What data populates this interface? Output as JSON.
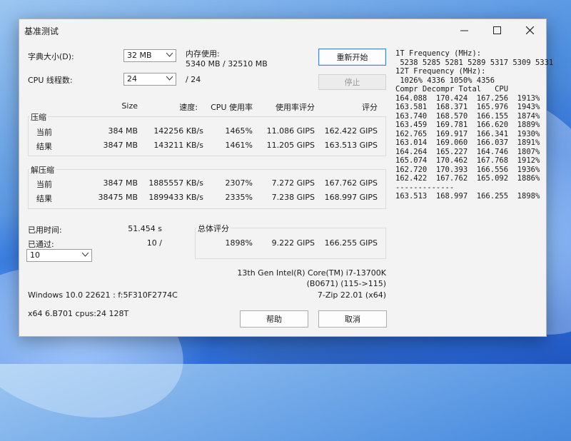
{
  "window": {
    "title": "基准测试",
    "controls": {
      "minimize": "—",
      "maximize": "☐",
      "close": "✕"
    }
  },
  "settings": {
    "dict_size_label": "字典大小(D):",
    "dict_size_value": "32 MB",
    "threads_label": "CPU 线程数:",
    "threads_value": "24",
    "threads_total": "/ 24",
    "memory_label": "内存使用:",
    "memory_value": "5340 MB / 32510 MB"
  },
  "buttons": {
    "restart": "重新开始",
    "stop": "停止",
    "help": "帮助",
    "cancel": "取消"
  },
  "table_header": {
    "size": "Size",
    "speed": "速度:",
    "cpu_usage": "CPU 使用率",
    "rating_per_usage": "使用率评分",
    "rating": "评分"
  },
  "compress": {
    "title": "压缩",
    "rows": [
      {
        "label": "当前",
        "size": "384 MB",
        "speed": "142256 KB/s",
        "usage": "1465%",
        "rpu": "11.086 GIPS",
        "rating": "162.422 GIPS"
      },
      {
        "label": "结果",
        "size": "3847 MB",
        "speed": "143211 KB/s",
        "usage": "1461%",
        "rpu": "11.205 GIPS",
        "rating": "163.513 GIPS"
      }
    ]
  },
  "decompress": {
    "title": "解压缩",
    "rows": [
      {
        "label": "当前",
        "size": "3847 MB",
        "speed": "1885557 KB/s",
        "usage": "2307%",
        "rpu": "7.272 GIPS",
        "rating": "167.762 GIPS"
      },
      {
        "label": "结果",
        "size": "38475 MB",
        "speed": "1899433 KB/s",
        "usage": "2335%",
        "rpu": "7.238 GIPS",
        "rating": "168.997 GIPS"
      }
    ]
  },
  "timing": {
    "elapsed_label": "已用时间:",
    "elapsed_value": "51.454 s",
    "passes_label": "已通过:",
    "passes_value": "10 /",
    "passes_select": "10"
  },
  "total": {
    "title": "总体评分",
    "usage": "1898%",
    "rpu": "9.222 GIPS",
    "rating": "166.255 GIPS"
  },
  "system": {
    "cpu_name": "13th Gen Intel(R) Core(TM) i7-13700K",
    "cpu_detail": "(B0671) (115->115)",
    "os": "Windows 10.0 22621 :  f:5F310F2774C",
    "version": "7-Zip 22.01 (x64)",
    "arch": "x64 6.B701 cpus:24 128T"
  },
  "side_panel": {
    "lines": [
      "1T Frequency (MHz):",
      " 5238 5285 5281 5289 5317 5309 5331",
      "12T Frequency (MHz):",
      " 1026% 4336 1050% 4356",
      "Compr Decompr Total   CPU",
      "164.088  170.424  167.256  1913%",
      "163.581  168.371  165.976  1943%",
      "163.740  168.570  166.155  1874%",
      "163.459  169.781  166.620  1889%",
      "162.765  169.917  166.341  1930%",
      "163.014  169.060  166.037  1891%",
      "164.264  165.227  164.746  1807%",
      "165.074  170.462  167.768  1912%",
      "162.720  170.393  166.556  1936%",
      "162.422  167.762  165.092  1886%",
      "-------------",
      "163.513  168.997  166.255  1898%"
    ]
  }
}
